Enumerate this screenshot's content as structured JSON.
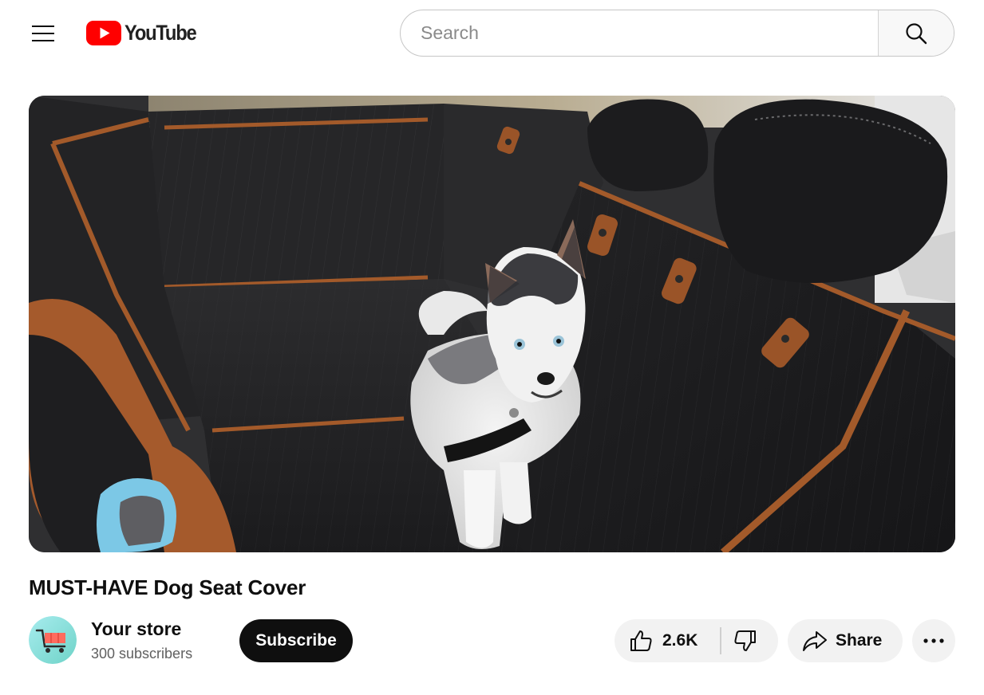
{
  "header": {
    "menu_icon": "hamburger-menu-icon",
    "logo_text": "YouTube",
    "logo_icon": "youtube-play-icon",
    "brand_color": "#ff0000",
    "search": {
      "placeholder": "Search",
      "value": "",
      "button_icon": "search-icon"
    }
  },
  "video": {
    "title": "MUST-HAVE Dog Seat Cover"
  },
  "channel": {
    "name": "Your store",
    "subscribers": "300 subscribers",
    "avatar_icon": "shopping-cart-icon",
    "subscribe_label": "Subscribe"
  },
  "actions": {
    "like_count": "2.6K",
    "like_icon": "thumbs-up-icon",
    "dislike_icon": "thumbs-down-icon",
    "share_label": "Share",
    "share_icon": "share-arrow-icon",
    "more_icon": "more-horizontal-icon"
  }
}
